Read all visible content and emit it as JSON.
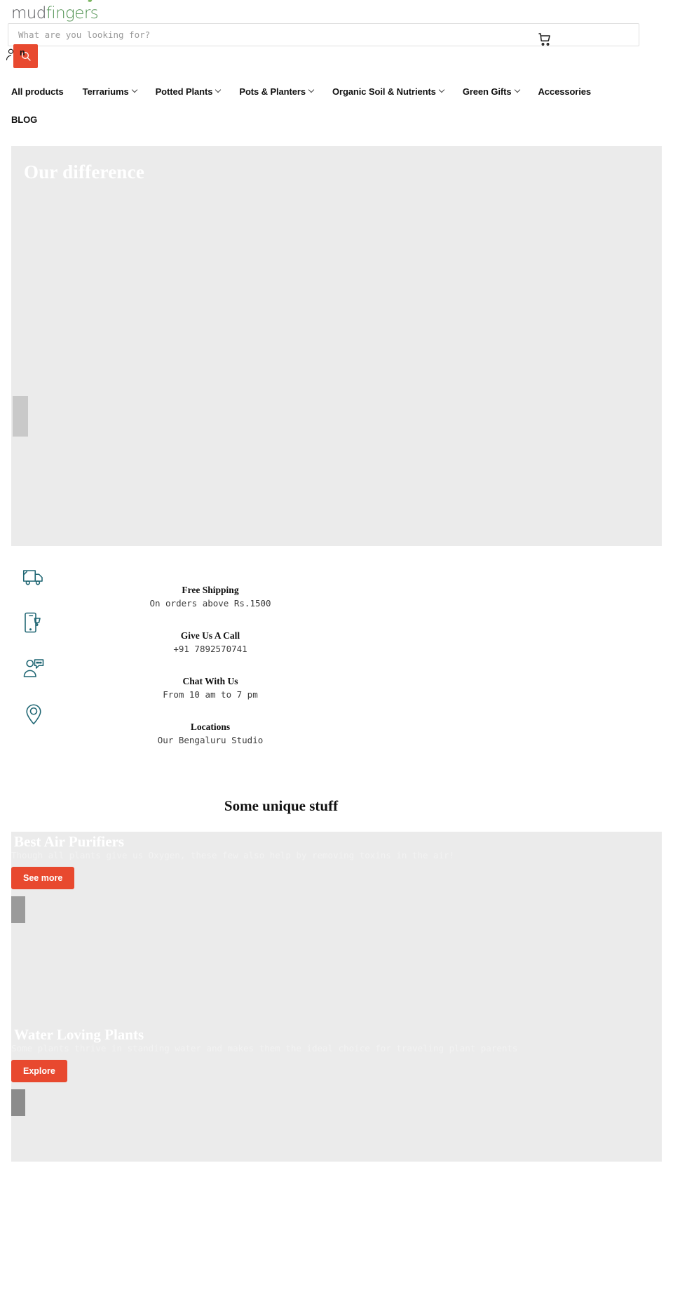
{
  "brand": {
    "name_part1": "mud",
    "name_part2": "fingers"
  },
  "header": {
    "search_placeholder": "What are you looking for?",
    "search_value": "",
    "search_icon": "search-icon",
    "account_label": "n",
    "account_icon": "person-icon",
    "cart_icon": "cart-icon"
  },
  "nav": {
    "items": [
      {
        "label": "All products",
        "has_dropdown": false
      },
      {
        "label": "Terrariums",
        "has_dropdown": true
      },
      {
        "label": "Potted Plants",
        "has_dropdown": true
      },
      {
        "label": "Pots & Planters",
        "has_dropdown": true
      },
      {
        "label": "Organic Soil & Nutrients",
        "has_dropdown": true
      },
      {
        "label": "Green Gifts",
        "has_dropdown": true
      },
      {
        "label": "Accessories",
        "has_dropdown": false
      }
    ],
    "secondary": [
      {
        "label": "BLOG",
        "has_dropdown": false
      }
    ]
  },
  "hero": {
    "title": "Our difference"
  },
  "features": [
    {
      "icon": "truck-icon",
      "title": "Free Shipping",
      "subtitle": "On orders above Rs.1500"
    },
    {
      "icon": "mobile-cart-icon",
      "title": "Give Us A Call",
      "subtitle": "+91 7892570741"
    },
    {
      "icon": "person-chat-icon",
      "title": "Chat With Us",
      "subtitle": "From 10 am to 7 pm"
    },
    {
      "icon": "location-pin-icon",
      "title": "Locations",
      "subtitle": "Our Bengaluru Studio"
    }
  ],
  "unique": {
    "heading": "Some unique stuff",
    "promos": [
      {
        "title": "Best Air Purifiers",
        "subtitle": "Though all plants give us Oxygen, these few also help by removing toxins in the air!",
        "button": "See more"
      },
      {
        "title": "Water Loving Plants",
        "subtitle": "Some plants thrive in standing water and makes them the ideal choice for traveling plant parents",
        "button": "Explore"
      }
    ]
  },
  "colors": {
    "accent": "#e8492f",
    "logo_green": "#4f9150",
    "icon_teal": "#1f6673",
    "placeholder_gray": "#ebebeb"
  }
}
